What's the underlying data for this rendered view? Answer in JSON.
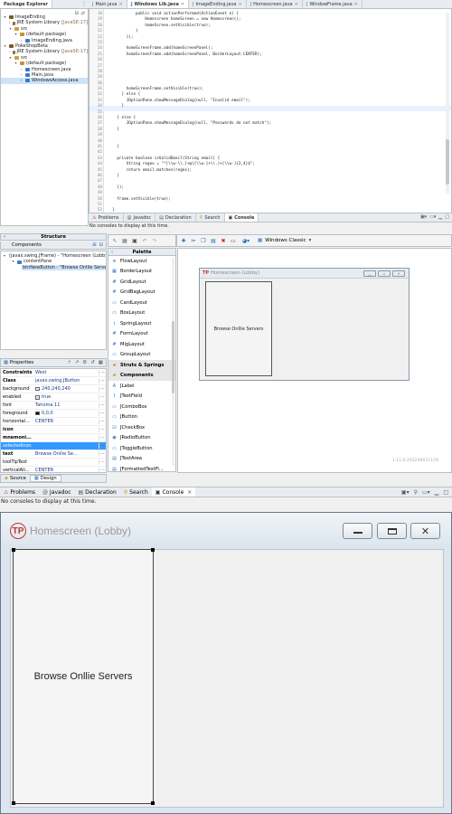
{
  "explorer": {
    "tabs": [
      "Package Explorer"
    ],
    "tree": [
      {
        "indent": 0,
        "tri": "▾",
        "label": "ImageEnding",
        "icon": "project-icon"
      },
      {
        "indent": 1,
        "tri": "›",
        "label": "JRE System Library",
        "extra": "[JavaSE-17]",
        "icon": "library-icon"
      },
      {
        "indent": 1,
        "tri": "▾",
        "label": "src",
        "icon": "folder-icon"
      },
      {
        "indent": 2,
        "tri": "▾",
        "label": "(default package)",
        "icon": "package-icon"
      },
      {
        "indent": 3,
        "tri": "›",
        "label": "ImageEnding.java",
        "icon": "java-file-icon"
      },
      {
        "indent": 0,
        "tri": "▾",
        "label": "PokeShopBeta",
        "icon": "project-icon"
      },
      {
        "indent": 1,
        "tri": "›",
        "label": "JRE System Library",
        "extra": "[JavaSE-17]",
        "icon": "library-icon"
      },
      {
        "indent": 1,
        "tri": "▾",
        "label": "src",
        "icon": "folder-icon"
      },
      {
        "indent": 2,
        "tri": "▾",
        "label": "(default package)",
        "icon": "package-icon"
      },
      {
        "indent": 3,
        "tri": "›",
        "label": "Homescreen.java",
        "icon": "java-file-icon"
      },
      {
        "indent": 3,
        "tri": "›",
        "label": "Main.java",
        "icon": "java-file-icon"
      },
      {
        "indent": 3,
        "tri": "›",
        "label": "WindowsAccess.java",
        "icon": "java-file-icon",
        "selected": true
      }
    ]
  },
  "editor": {
    "tabs": [
      "Main.java",
      "Windows Lib.java",
      "ImageEnding.java",
      "Homescreen.java",
      "WindowFrame.java"
    ],
    "active_tab": 1,
    "line_numbers": [
      "18",
      "19",
      "20",
      "21",
      "22",
      "23",
      "24",
      "25",
      "26",
      "27",
      "28",
      "29",
      "30",
      "31",
      "32",
      "33",
      "34",
      "35",
      "36",
      "37",
      "38",
      "39",
      "40",
      "41",
      "42",
      "43",
      "44",
      "45",
      "46",
      "47",
      "48",
      "49",
      "50",
      "51",
      "52",
      "53"
    ],
    "lines": [
      "            public void actionPerformed(ActionEvent e) {",
      "                Homescreen homeScreen = new Homescreen();",
      "                homeScreen.setVisible(true);",
      "            }",
      "        });",
      "",
      "        homeScreenFrame.add(homeScreenPanel);",
      "        homeScreenFrame.add(homeScreenPanel, BorderLayout.CENTER);",
      "",
      "",
      "",
      "",
      "",
      "        homeScreenFrame.setVisible(true);",
      "      } else {",
      "        JOptionPane.showMessageDialog(null, \"Invalid email\");",
      "      }",
      "",
      "    } else {",
      "        JOptionPane.showMessageDialog(null, \"Passwords do not match\");",
      "    }",
      "",
      "",
      "    }",
      "",
      "    private boolean isValidEmail(String email) {",
      "        String regex = \"^[\\\\w-\\\\.]+@([\\\\w-]+\\\\.)+[\\\\w-]{2,4}$\";",
      "        return email.matches(regex);",
      "    }",
      "",
      "    });",
      "",
      "    frame.setVisible(true);",
      "",
      "  }",
      "}"
    ],
    "bottom_tabs": [
      "Problems",
      "Javadoc",
      "Declaration",
      "Search",
      "Console"
    ],
    "console_text": "No consoles to display at this time."
  },
  "structure": {
    "title": "Structure",
    "components_label": "Components",
    "tree": [
      {
        "indent": 0,
        "label": "(javax.swing.JFrame) - \"Homescreen (Lobby)\""
      },
      {
        "indent": 1,
        "label": "contentPane"
      },
      {
        "indent": 2,
        "label": "btnNewButton - \"Browse Onllie Servers\"",
        "selected": true
      }
    ]
  },
  "properties": {
    "title": "Properties",
    "rows": [
      {
        "k": "Constraints",
        "v": "West",
        "bold": true
      },
      {
        "k": "Class",
        "v": "javax.swing.JButton",
        "bold": true
      },
      {
        "k": "background",
        "v": "240,240,240",
        "swatch": "#f0f0f0"
      },
      {
        "k": "enabled",
        "v": "true",
        "check": true
      },
      {
        "k": "font",
        "v": "Tahoma 11"
      },
      {
        "k": "foreground",
        "v": "0,0,0",
        "swatch": "#000000"
      },
      {
        "k": "horizontal...",
        "v": "CENTER"
      },
      {
        "k": "icon",
        "v": "",
        "bold": true
      },
      {
        "k": "mnemoni...",
        "v": "",
        "bold": true
      },
      {
        "k": "selectedIcon",
        "v": "",
        "selected": true
      },
      {
        "k": "text",
        "v": "Browse Onllie Se...",
        "bold": true
      },
      {
        "k": "toolTipText",
        "v": ""
      },
      {
        "k": "verticalAli...",
        "v": "CENTER"
      }
    ]
  },
  "palette": {
    "title": "Palette",
    "items": [
      {
        "label": "FlowLayout",
        "icon": "flow-layout-icon",
        "glyph": "≡"
      },
      {
        "label": "BorderLayout",
        "icon": "border-layout-icon",
        "glyph": "▦"
      },
      {
        "label": "GridLayout",
        "icon": "grid-layout-icon",
        "glyph": "#"
      },
      {
        "label": "GridBagLayout",
        "icon": "gridbag-layout-icon",
        "glyph": "#"
      },
      {
        "label": "CardLayout",
        "icon": "card-layout-icon",
        "glyph": "▭"
      },
      {
        "label": "BoxLayout",
        "icon": "box-layout-icon",
        "glyph": "▭"
      },
      {
        "label": "SpringLayout",
        "icon": "spring-layout-icon",
        "glyph": "⌇"
      },
      {
        "label": "FormLayout",
        "icon": "form-layout-icon",
        "glyph": "#"
      },
      {
        "label": "MigLayout",
        "icon": "mig-layout-icon",
        "glyph": "#"
      },
      {
        "label": "GroupLayout",
        "icon": "group-layout-icon",
        "glyph": "▭"
      },
      {
        "label": "Struts & Springs",
        "icon": "folder-icon",
        "glyph": "▰",
        "category": true
      },
      {
        "label": "Components",
        "icon": "folder-icon",
        "glyph": "▰",
        "category": true
      },
      {
        "label": "JLabel",
        "icon": "jlabel-icon",
        "glyph": "A"
      },
      {
        "label": "JTextField",
        "icon": "jtextfield-icon",
        "glyph": "I"
      },
      {
        "label": "JComboBox",
        "icon": "jcombobox-icon",
        "glyph": "▭"
      },
      {
        "label": "JButton",
        "icon": "jbutton-icon",
        "glyph": "▭"
      },
      {
        "label": "JCheckBox",
        "icon": "jcheckbox-icon",
        "glyph": "☑"
      },
      {
        "label": "JRadioButton",
        "icon": "jradiobutton-icon",
        "glyph": "◉"
      },
      {
        "label": "JToggleButton",
        "icon": "jtogglebutton-icon",
        "glyph": "▭"
      },
      {
        "label": "JTextArea",
        "icon": "jtextarea-icon",
        "glyph": "▤"
      },
      {
        "label": "JFormattedTextFi...",
        "icon": "jformattedtextfield-icon",
        "glyph": "▤"
      }
    ]
  },
  "designer": {
    "layout_combo": "Windows Classic",
    "preview_title": "Homescreen (Lobby)",
    "button_text": "Browse Onllie Servers",
    "version": "1.11.0.202208021159",
    "bottom_tabs": [
      "Source",
      "Design"
    ],
    "active_bottom_tab": 1
  },
  "bottom_views": {
    "tabs": [
      "Problems",
      "Javadoc",
      "Declaration",
      "Search",
      "Console"
    ],
    "active_tab": 4,
    "console_text": "No consoles to display at this time."
  },
  "window": {
    "title": "Homescreen (Lobby)",
    "button_text": "Browse Onllie Servers"
  },
  "colors": {
    "accent_blue": "#3399ff",
    "title_gray": "#9a9a9a",
    "brand_red": "#c0392b"
  }
}
